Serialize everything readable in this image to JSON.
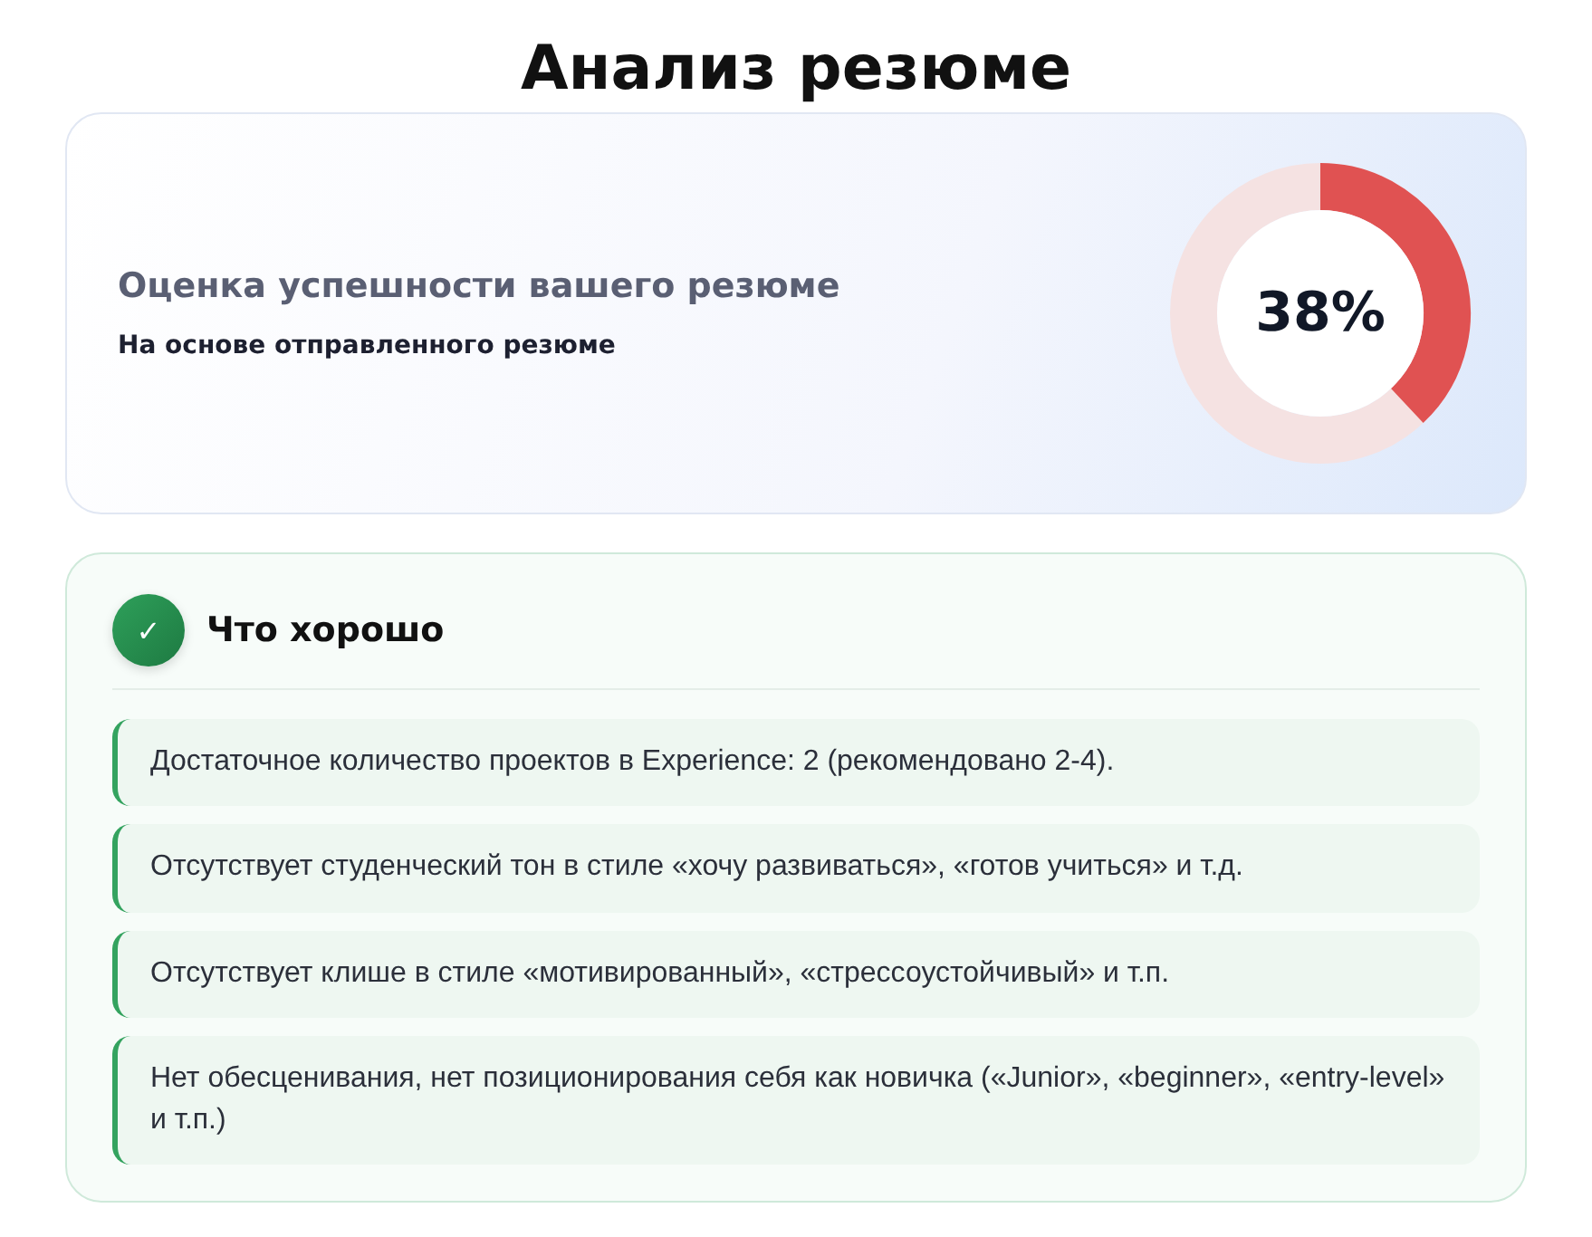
{
  "title": "Анализ резюме",
  "score": {
    "heading": "Оценка успешности вашего резюме",
    "subtitle": "На основе отправленного резюме",
    "reading": "38%"
  },
  "good": {
    "icon": "✓",
    "heading": "Что хорошо",
    "items": [
      "Достаточное количество проектов в Experience: 2 (рекомендовано 2-4).",
      "Отсутствует студенческий тон в стиле «хочу развиваться», «готов учиться» и т.д.",
      "Отсутствует клише в стиле «мотивированный», «стрессоустойчивый» и т.п.",
      "Нет обесценивания, нет позиционирования себя как новичка («Junior», «beginner», «entry-level» и т.п.)"
    ]
  }
}
